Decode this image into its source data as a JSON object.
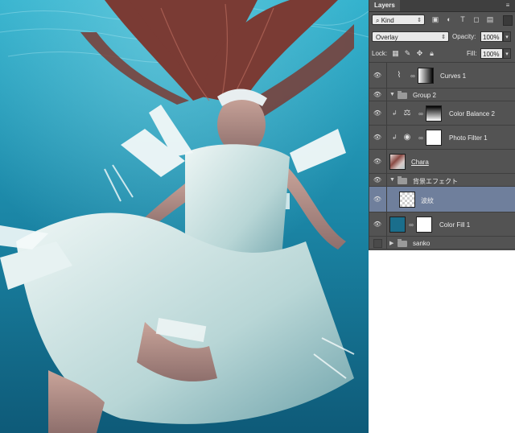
{
  "panel": {
    "tab_label": "Layers",
    "filter": {
      "kind_label": "Kind"
    },
    "blend_mode": "Overlay",
    "opacity_label": "Opacity:",
    "opacity_value": "100%",
    "lock_label": "Lock:",
    "fill_label": "Fill:",
    "fill_value": "100%",
    "layers": [
      {
        "name": "Curves 1",
        "visible": true,
        "type": "adjustment",
        "icon": "curves-icon"
      },
      {
        "name": "Group 2",
        "visible": true,
        "type": "group",
        "expanded": true
      },
      {
        "name": "Color Balance 2",
        "visible": true,
        "type": "adjustment",
        "icon": "color-balance-icon",
        "clipped": true
      },
      {
        "name": "Photo Filter 1",
        "visible": true,
        "type": "adjustment",
        "icon": "photo-filter-icon",
        "clipped": true
      },
      {
        "name": "Chara",
        "visible": true,
        "type": "pixel"
      },
      {
        "name": "背景エフェクト",
        "visible": true,
        "type": "group",
        "expanded": true
      },
      {
        "name": "波紋",
        "visible": true,
        "type": "pixel",
        "selected": true
      },
      {
        "name": "Color Fill 1",
        "visible": true,
        "type": "fill"
      },
      {
        "name": "sanko",
        "visible": false,
        "type": "group",
        "expanded": false
      }
    ]
  },
  "colors": {
    "water_top": "#2aa6c6",
    "water_bottom": "#0f5f80",
    "panel_bg": "#535353",
    "selected_row": "#6f7f9c",
    "fill_swatch": "#1a6e8c"
  }
}
